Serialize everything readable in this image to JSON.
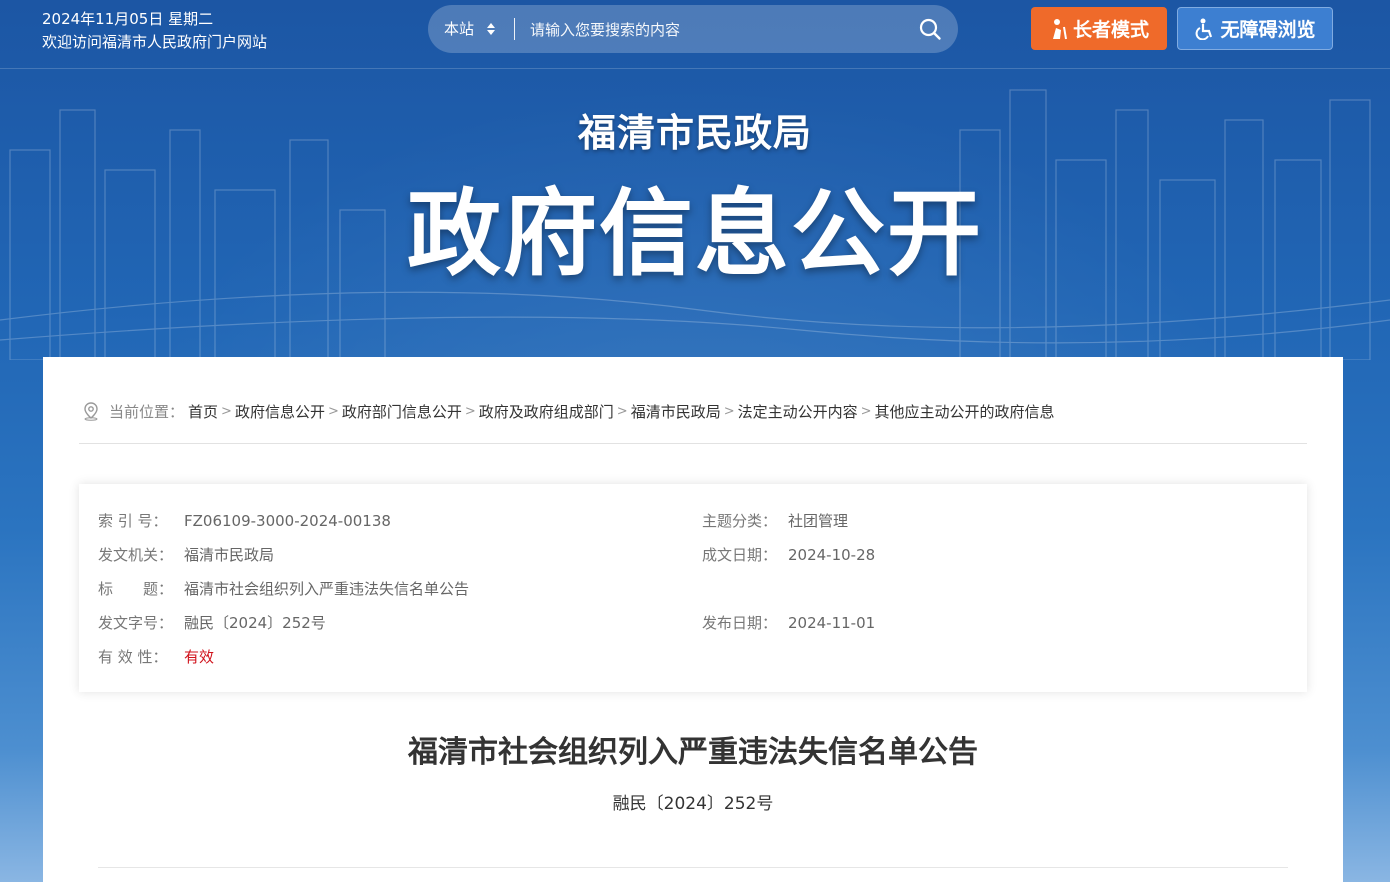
{
  "header": {
    "date": "2024年11月05日 星期二",
    "welcome": "欢迎访问福清市人民政府门户网站",
    "search": {
      "scope": "本站",
      "placeholder": "请输入您要搜索的内容"
    },
    "elder_mode_label": "长者模式",
    "accessibility_label": "无障碍浏览",
    "colors": {
      "elder_button": "#ef6a2a",
      "accessibility_button": "#3d7fd1",
      "banner": "#1d63b1"
    }
  },
  "banner": {
    "department": "福清市民政局",
    "title": "政府信息公开"
  },
  "breadcrumb": {
    "label": "当前位置：",
    "items": [
      "首页",
      "政府信息公开",
      "政府部门信息公开",
      "政府及政府组成部门",
      "福清市民政局",
      "法定主动公开内容",
      "其他应主动公开的政府信息"
    ]
  },
  "meta": {
    "index_no": {
      "key": "索 引 号：",
      "value": "FZ06109-3000-2024-00138"
    },
    "issuer": {
      "key": "发文机关：",
      "value": "福清市民政局"
    },
    "title": {
      "key": "标　　题：",
      "value": "福清市社会组织列入严重违法失信名单公告"
    },
    "doc_no": {
      "key": "发文字号：",
      "value": "融民〔2024〕252号"
    },
    "validity": {
      "key": "有 效 性：",
      "value": "有效"
    },
    "category": {
      "key": "主题分类：",
      "value": "社团管理"
    },
    "written_date": {
      "key": "成文日期：",
      "value": "2024-10-28"
    },
    "publish_date": {
      "key": "发布日期：",
      "value": "2024-11-01"
    }
  },
  "document": {
    "title": "福清市社会组织列入严重违法失信名单公告",
    "number": "融民〔2024〕252号"
  },
  "icons": [
    "search-icon",
    "elder-icon",
    "wheelchair-icon",
    "location-pin-icon",
    "sort-arrows-icon"
  ]
}
